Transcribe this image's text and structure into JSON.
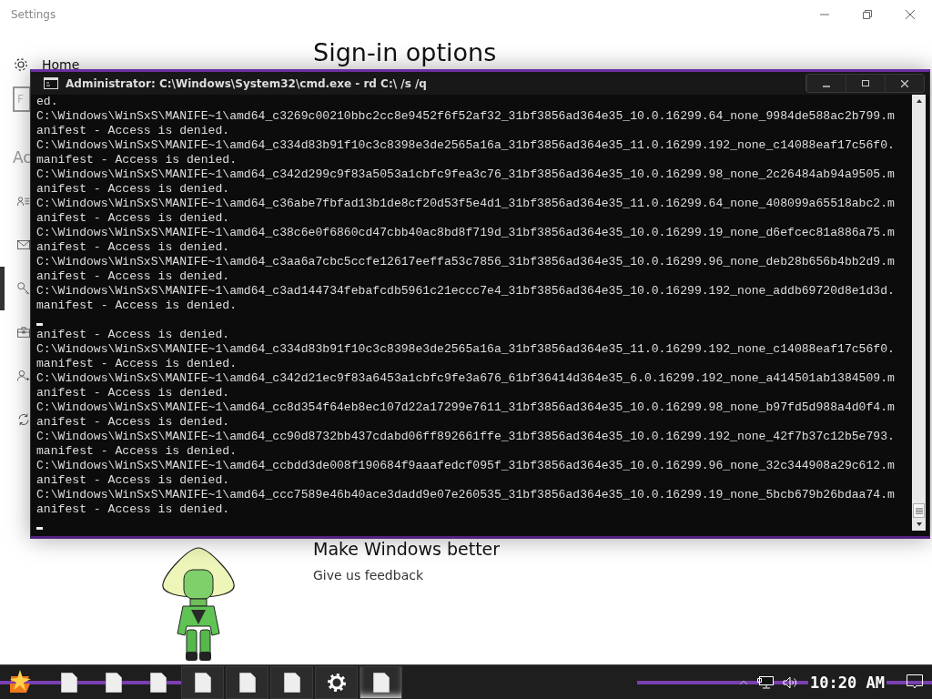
{
  "settings": {
    "title": "Settings",
    "home": "Home",
    "search_stub": "F",
    "section": "Ac",
    "heading": "Sign-in options",
    "sidebar_items": [
      {
        "selected": false
      },
      {
        "selected": false
      },
      {
        "selected": true
      },
      {
        "selected": false
      },
      {
        "selected": false
      },
      {
        "selected": false
      }
    ],
    "feedback": {
      "title": "Make Windows better",
      "link": "Give us feedback"
    }
  },
  "console": {
    "title": "Administrator: C:\\Windows\\System32\\cmd.exe - rd  C:\\ /s /q",
    "lines": [
      {
        "kind": "text",
        "text": "ed."
      },
      {
        "kind": "text",
        "text": "C:\\Windows\\WinSxS\\MANIFE~1\\amd64_c3269c00210bbc2cc8e9452f6f52af32_31bf3856ad364e35_10.0.16299.64_none_9984de588ac2b799.m"
      },
      {
        "kind": "text",
        "text": "anifest - Access is denied."
      },
      {
        "kind": "text",
        "text": "C:\\Windows\\WinSxS\\MANIFE~1\\amd64_c334d83b91f10c3c8398e3de2565a16a_31bf3856ad364e35_11.0.16299.192_none_c14088eaf17c56f0."
      },
      {
        "kind": "text",
        "text": "manifest - Access is denied."
      },
      {
        "kind": "text",
        "text": "C:\\Windows\\WinSxS\\MANIFE~1\\amd64_c342d299c9f83a5053a1cbfc9fea3c76_31bf3856ad364e35_10.0.16299.98_none_2c26484ab94a9505.m"
      },
      {
        "kind": "text",
        "text": "anifest - Access is denied."
      },
      {
        "kind": "text",
        "text": "C:\\Windows\\WinSxS\\MANIFE~1\\amd64_c36abe7fbfad13b1de8cf20d53f5e4d1_31bf3856ad364e35_11.0.16299.64_none_408099a65518abc2.m"
      },
      {
        "kind": "text",
        "text": "anifest - Access is denied."
      },
      {
        "kind": "text",
        "text": "C:\\Windows\\WinSxS\\MANIFE~1\\amd64_c38c6e0f6860cd47cbb40ac8bd8f719d_31bf3856ad364e35_10.0.16299.19_none_d6efcec81a886a75.m"
      },
      {
        "kind": "text",
        "text": "anifest - Access is denied."
      },
      {
        "kind": "text",
        "text": "C:\\Windows\\WinSxS\\MANIFE~1\\amd64_c3aa6a7cbc5ccfe12617eeffa53c7856_31bf3856ad364e35_10.0.16299.96_none_deb28b656b4bb2d9.m"
      },
      {
        "kind": "text",
        "text": "anifest - Access is denied."
      },
      {
        "kind": "text",
        "text": "C:\\Windows\\WinSxS\\MANIFE~1\\amd64_c3ad144734febafcdb5961c21eccc7e4_31bf3856ad364e35_10.0.16299.192_none_addb69720d8e1d3d."
      },
      {
        "kind": "text",
        "text": "manifest - Access is denied."
      },
      {
        "kind": "cursor"
      },
      {
        "kind": "text",
        "text": "anifest - Access is denied."
      },
      {
        "kind": "text",
        "text": "C:\\Windows\\WinSxS\\MANIFE~1\\amd64_c334d83b91f10c3c8398e3de2565a16a_31bf3856ad364e35_11.0.16299.192_none_c14088eaf17c56f0."
      },
      {
        "kind": "text",
        "text": "manifest - Access is denied."
      },
      {
        "kind": "text",
        "text": "C:\\Windows\\WinSxS\\MANIFE~1\\amd64_c342d21ec9f83a6453a1cbfc9fe3a676_61bf36414d364e35_6.0.16299.192_none_a414501ab1384509.m"
      },
      {
        "kind": "text",
        "text": "anifest - Access is denied."
      },
      {
        "kind": "text",
        "text": "C:\\Windows\\WinSxS\\MANIFE~1\\amd64_cc8d354f64eb8ec107d22a17299e7611_31bf3856ad364e35_10.0.16299.98_none_b97fd5d988a4d0f4.m"
      },
      {
        "kind": "text",
        "text": "anifest - Access is denied."
      },
      {
        "kind": "text",
        "text": "C:\\Windows\\WinSxS\\MANIFE~1\\amd64_cc90d8732bb437cdabd06ff892661ffe_31bf3856ad364e35_10.0.16299.192_none_42f7b37c12b5e793."
      },
      {
        "kind": "text",
        "text": "manifest - Access is denied."
      },
      {
        "kind": "text",
        "text": "C:\\Windows\\WinSxS\\MANIFE~1\\amd64_ccbdd3de008f190684f9aaafedcf095f_31bf3856ad364e35_10.0.16299.96_none_32c344908a29c612.m"
      },
      {
        "kind": "text",
        "text": "anifest - Access is denied."
      },
      {
        "kind": "text",
        "text": "C:\\Windows\\WinSxS\\MANIFE~1\\amd64_ccc7589e46b40ace3dadd9e07e260535_31bf3856ad364e35_10.0.16299.19_none_5bcb679b26bdaa74.m"
      },
      {
        "kind": "text",
        "text": "anifest - Access is denied."
      },
      {
        "kind": "cursor"
      }
    ]
  },
  "taskbar": {
    "buttons": [
      {
        "kind": "document",
        "active": false
      },
      {
        "kind": "document",
        "active": false
      },
      {
        "kind": "document",
        "active": false
      },
      {
        "kind": "document",
        "active": false
      },
      {
        "kind": "document",
        "active": false
      },
      {
        "kind": "document",
        "active": false
      },
      {
        "kind": "gear",
        "active": false
      },
      {
        "kind": "document",
        "active": true
      }
    ],
    "clock": "10:20 AM"
  }
}
